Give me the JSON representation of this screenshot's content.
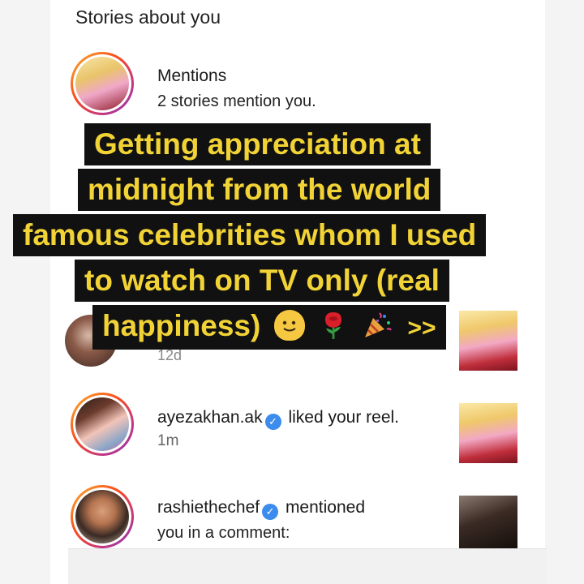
{
  "section": {
    "title": "Stories about you"
  },
  "rows": {
    "mentions": {
      "title": "Mentions",
      "subtitle": "2 stories mention you."
    },
    "partial": {
      "time": "12d"
    },
    "ayeza": {
      "username": "ayezakhan.ak",
      "action": "liked your reel.",
      "time": "1m"
    },
    "rashie": {
      "username": "rashiethechef",
      "action": "mentioned",
      "line2": "you in a comment:"
    }
  },
  "overlay": {
    "lines": [
      "Getting appreciation  at",
      "midnight  from the world",
      "famous celebrities whom I used",
      "to watch on TV only (real",
      "happiness)"
    ],
    "suffix": ">>",
    "emojis": [
      "melting-face",
      "rose",
      "party-popper"
    ]
  },
  "colors": {
    "overlay_background": "#111111",
    "overlay_text": "#f2d336",
    "verified_badge": "#3b8ced",
    "story_ring": "#c13584"
  },
  "icons": {
    "verified": "verified-badge-icon"
  }
}
